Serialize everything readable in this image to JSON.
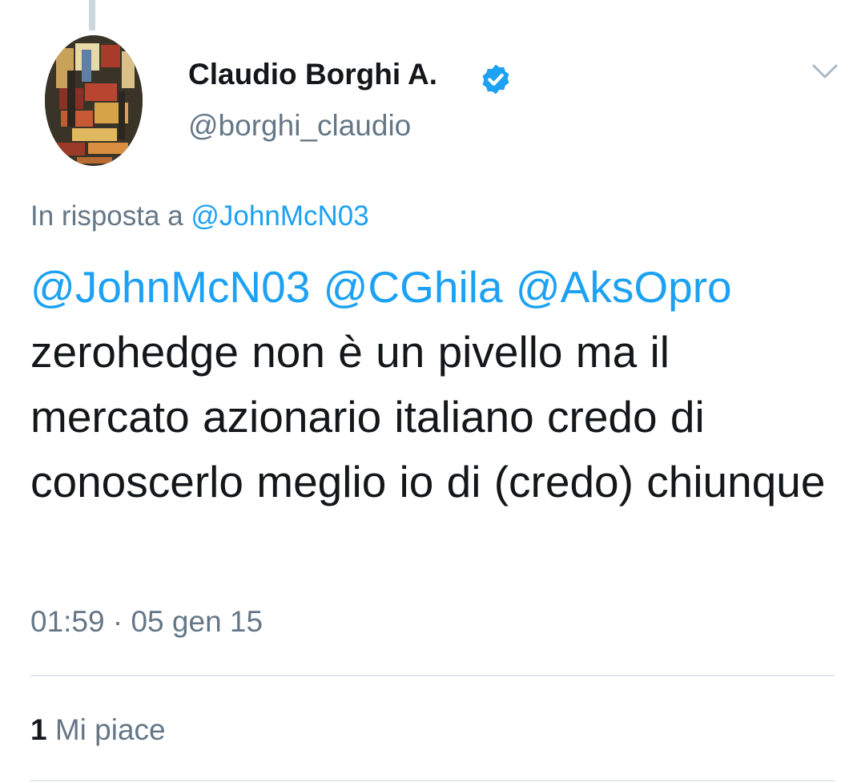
{
  "tweet": {
    "author": {
      "display_name": "Claudio Borghi A.",
      "handle": "@borghi_claudio",
      "verified": true
    },
    "reply_prefix": "In risposta a",
    "reply_to": "@JohnMcN03",
    "mentions": [
      "@JohnMcN03",
      "@CGhila",
      "@AksOpro"
    ],
    "text": "zerohedge non è un pivello ma il mercato azionario italiano credo di conoscerlo meglio io di (credo) chiunque",
    "time": "01:59",
    "separator": "·",
    "date": "05 gen 15",
    "likes_count": "1",
    "likes_label": "Mi piace"
  },
  "icons": {
    "verified": "verified-badge-icon",
    "menu": "chevron-down-icon"
  },
  "colors": {
    "accent": "#1da1f2",
    "text": "#14171a",
    "secondary": "#657786",
    "divider": "#e1e8ed"
  }
}
